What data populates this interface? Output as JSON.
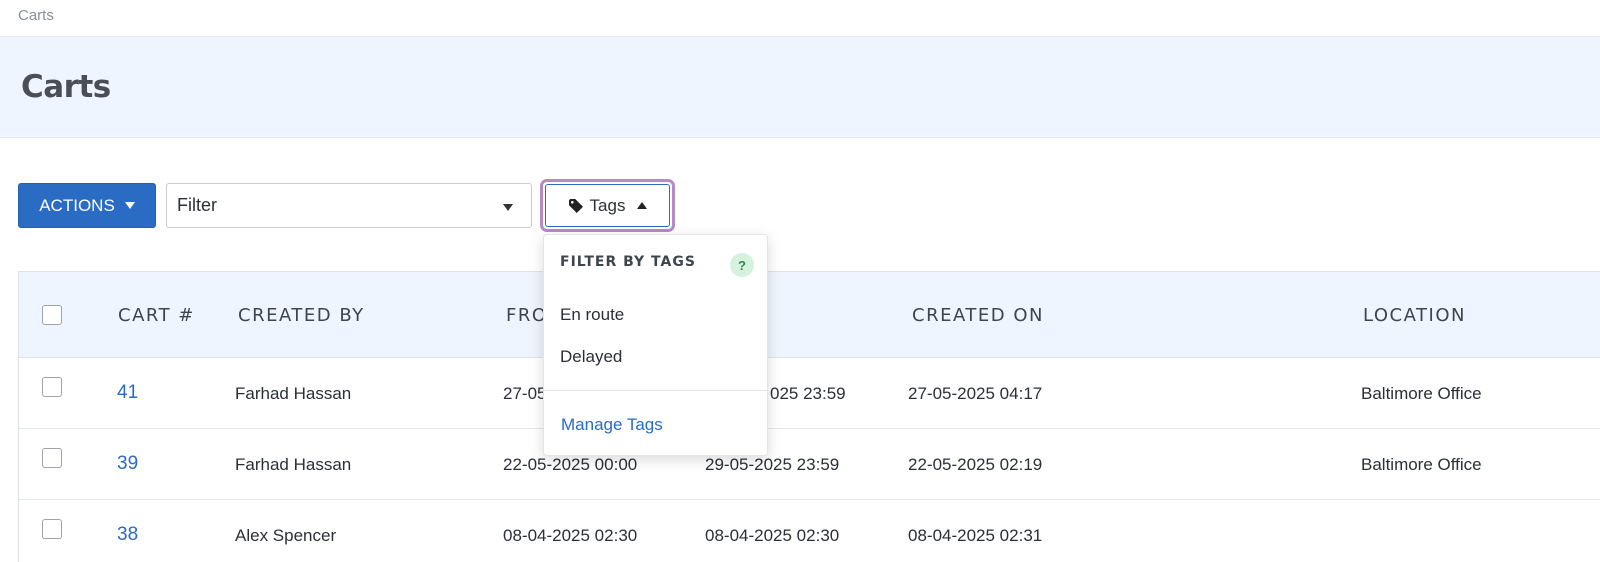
{
  "breadcrumb": "Carts",
  "page_title": "Carts",
  "toolbar": {
    "actions_label": "ACTIONS",
    "filter_value": "Filter",
    "tags_label": "Tags"
  },
  "table": {
    "headers": [
      "CART #",
      "CREATED BY",
      "FRO",
      "CREATED ON",
      "LOCATION"
    ],
    "rows": [
      {
        "cart": "41",
        "created_by": "Farhad Hassan",
        "from": "27-05",
        "to": "025 23:59",
        "created_on": "27-05-2025 04:17",
        "location": "Baltimore Office"
      },
      {
        "cart": "39",
        "created_by": "Farhad Hassan",
        "from": "22-05-2025 00:00",
        "to": "29-05-2025 23:59",
        "created_on": "22-05-2025 02:19",
        "location": "Baltimore Office"
      },
      {
        "cart": "38",
        "created_by": "Alex Spencer",
        "from": "08-04-2025 02:30",
        "to": "08-04-2025 02:30",
        "created_on": "08-04-2025 02:31",
        "location": ""
      }
    ]
  },
  "tags_dropdown": {
    "title": "FILTER BY TAGS",
    "help": "?",
    "items": [
      "En route",
      "Delayed"
    ],
    "manage_label": "Manage Tags"
  },
  "colors": {
    "primary": "#2a6bc4",
    "header_bg": "#eef5fe",
    "focus_ring": "#b48bc4",
    "help_badge": "#d6f1de"
  }
}
